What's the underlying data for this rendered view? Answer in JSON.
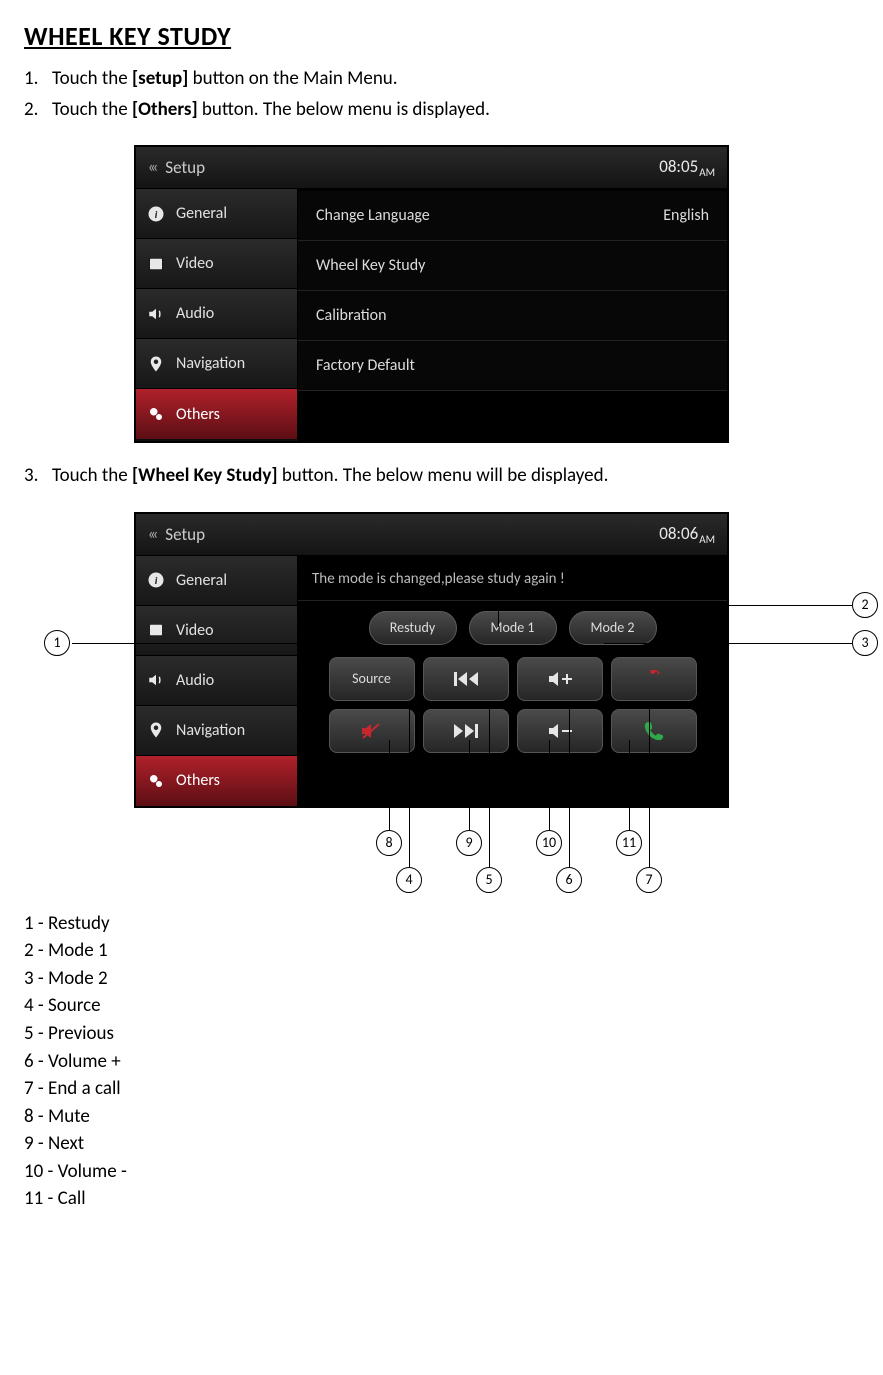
{
  "title": "WHEEL KEY STUDY",
  "steps": {
    "s1_num": "1.",
    "s1_a": "Touch the ",
    "s1_b": "[setup]",
    "s1_c": " button on the Main Menu.",
    "s2_num": "2.",
    "s2_a": "Touch the ",
    "s2_b": "[Others]",
    "s2_c": " button. The below menu is displayed.",
    "s3_num": "3.",
    "s3_a": "Touch the ",
    "s3_b": "[Wheel Key Study]",
    "s3_c": " button. The below menu will be displayed."
  },
  "screenshot1": {
    "setup_label": "Setup",
    "clock_time": "08:05",
    "clock_ampm": "AM",
    "sidebar": {
      "general": "General",
      "video": "Video",
      "audio": "Audio",
      "navigation": "Navigation",
      "others": "Others"
    },
    "rows": {
      "change_language_label": "Change Language",
      "change_language_value": "English",
      "wheel_key_study": "Wheel Key Study",
      "calibration": "Calibration",
      "factory_default": "Factory Default"
    }
  },
  "screenshot2": {
    "setup_label": "Setup",
    "clock_time": "08:06",
    "clock_ampm": "AM",
    "notice": "The mode is changed,please study again !",
    "sidebar": {
      "general": "General",
      "video": "Video",
      "audio": "Audio",
      "navigation": "Navigation",
      "others": "Others"
    },
    "buttons": {
      "restudy": "Restudy",
      "mode1": "Mode 1",
      "mode2": "Mode 2",
      "source": "Source"
    }
  },
  "callouts": {
    "c1": "1",
    "c2": "2",
    "c3": "3",
    "c4": "4",
    "c5": "5",
    "c6": "6",
    "c7": "7",
    "c8": "8",
    "c9": "9",
    "c10": "10",
    "c11": "11"
  },
  "legend": {
    "l1": "1 -  Restudy",
    "l2": "2 -  Mode 1",
    "l3": "3 -  Mode 2",
    "l4": "4 -  Source",
    "l5": "5 -  Previous",
    "l6": "6 -  Volume +",
    "l7": "7 -  End a call",
    "l8": "8 -  Mute",
    "l9": "9 -  Next",
    "l10": "10 - Volume -",
    "l11": "11 - Call"
  }
}
